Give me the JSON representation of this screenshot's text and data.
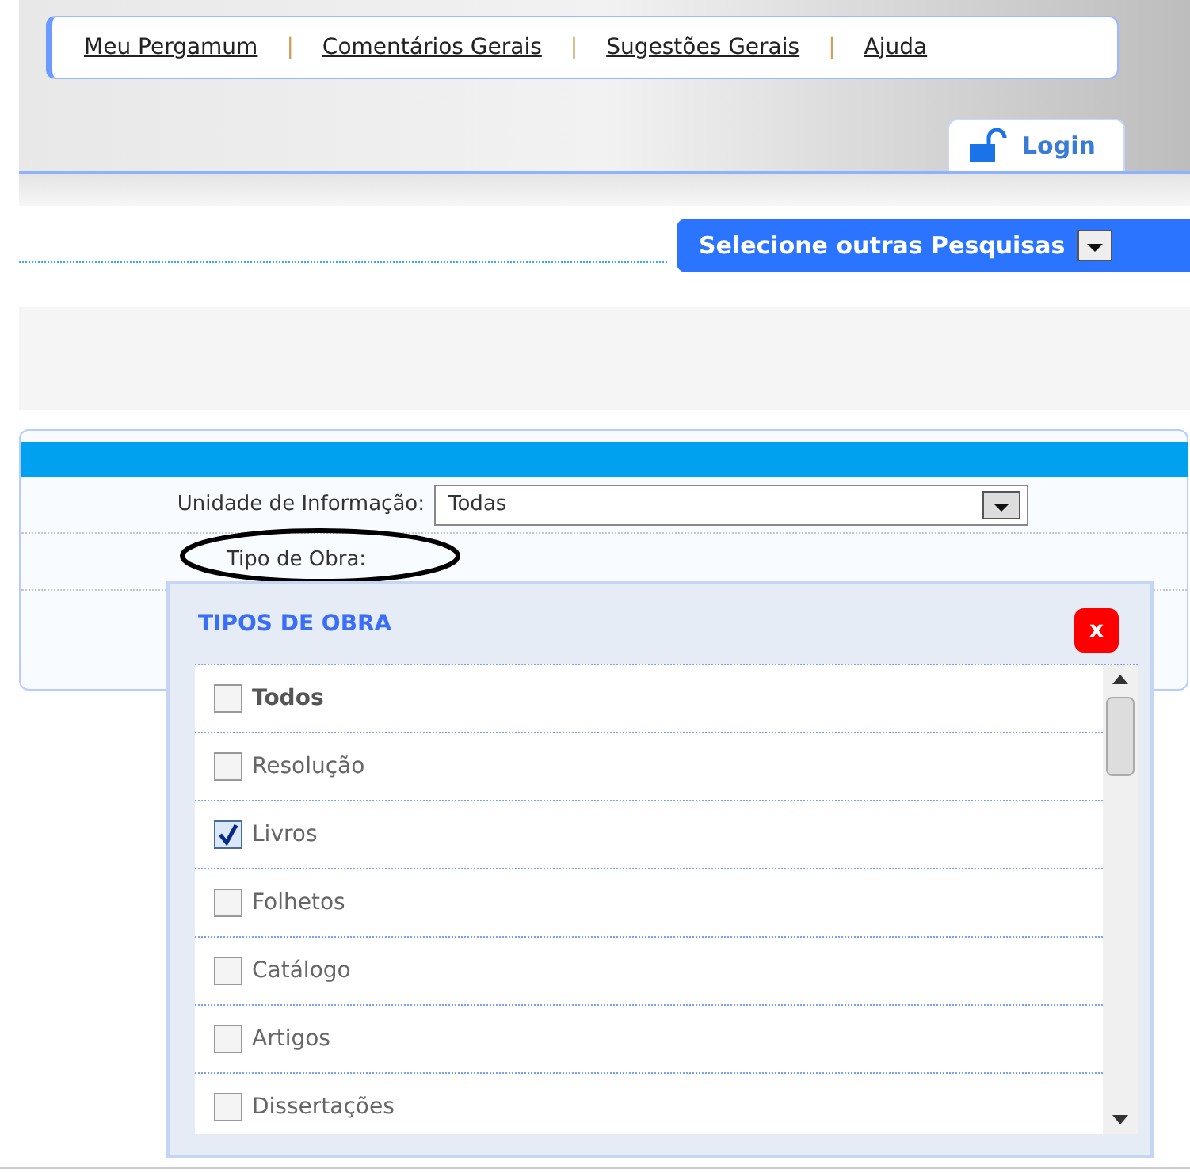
{
  "top_links": [
    "Meu Pergamum",
    "Comentários Gerais",
    "Sugestões Gerais",
    "Ajuda"
  ],
  "separator": "|",
  "login": "Login",
  "other_searches": "Selecione outras Pesquisas",
  "form": {
    "unit_label": "Unidade de Informação:",
    "unit_value": "Todas",
    "type_label": "Tipo de Obra:",
    "type_label_circled": true
  },
  "popup": {
    "title": "TIPOS DE OBRA",
    "close": "x",
    "items": [
      {
        "label": "Todos",
        "checked": false,
        "bold": true
      },
      {
        "label": "Resolução",
        "checked": false,
        "bold": false
      },
      {
        "label": "Livros",
        "checked": true,
        "bold": false
      },
      {
        "label": "Folhetos",
        "checked": false,
        "bold": false
      },
      {
        "label": "Catálogo",
        "checked": false,
        "bold": false
      },
      {
        "label": "Artigos",
        "checked": false,
        "bold": false
      },
      {
        "label": "Dissertações",
        "checked": false,
        "bold": false
      }
    ]
  }
}
